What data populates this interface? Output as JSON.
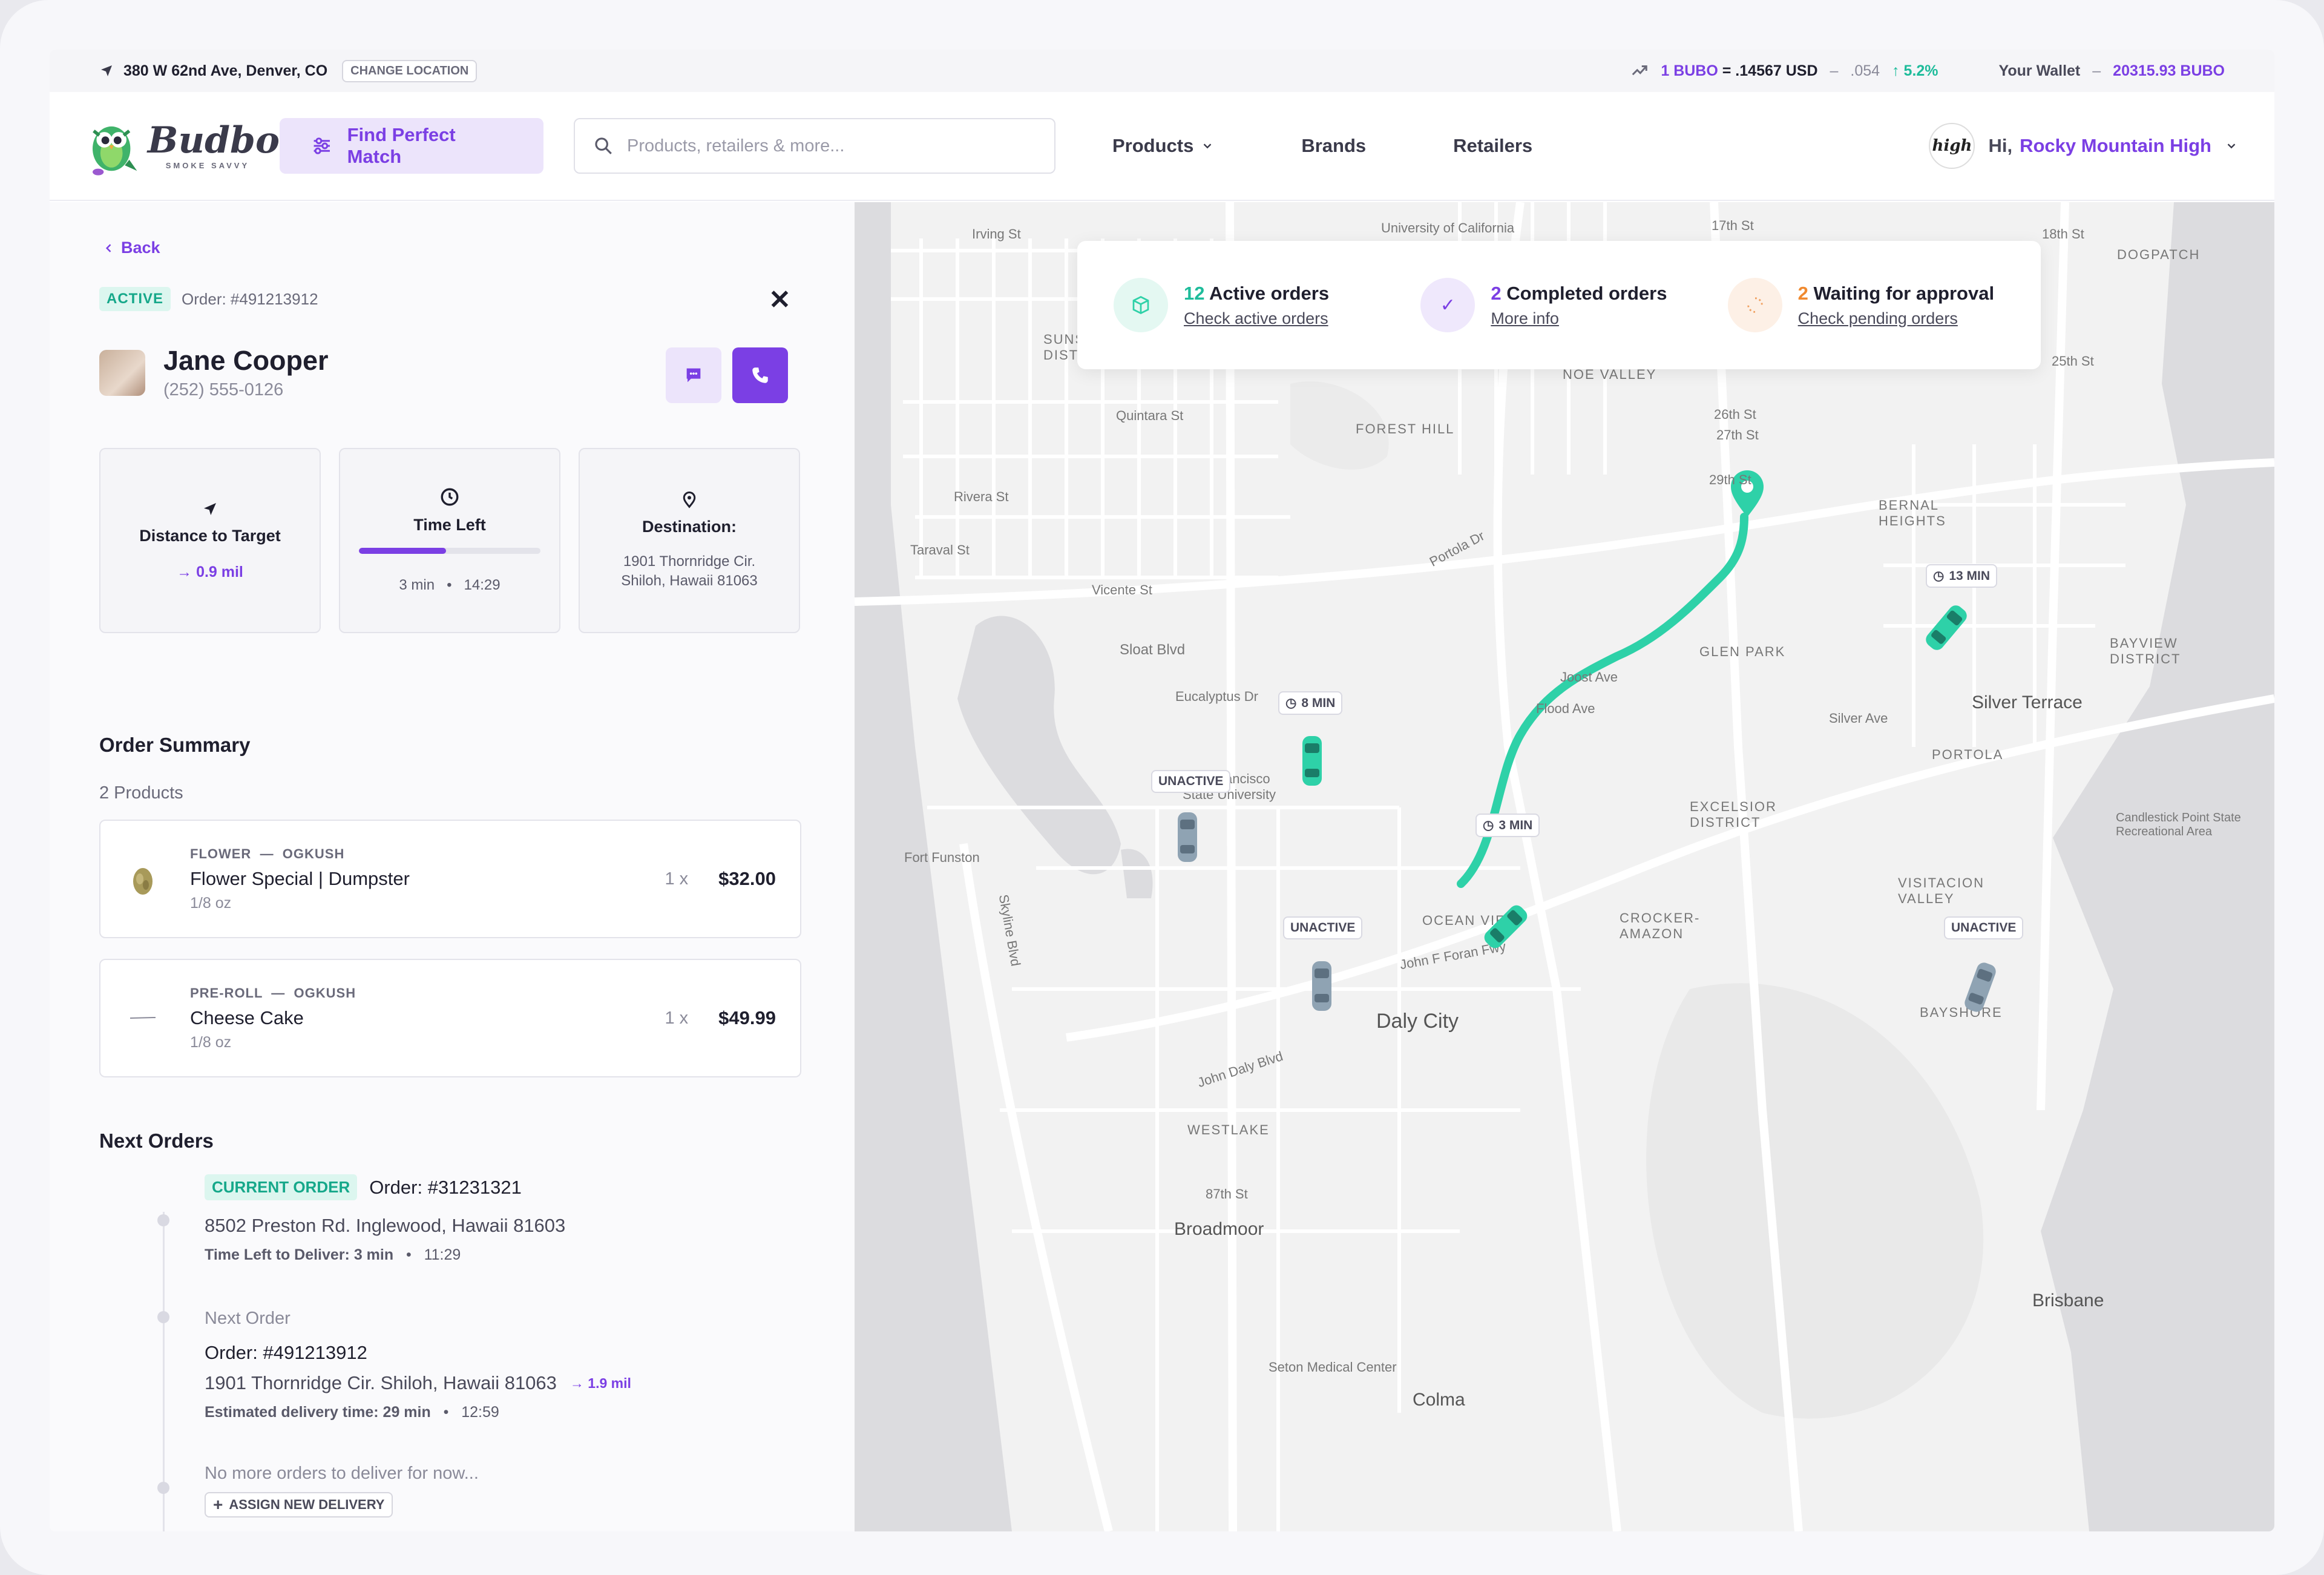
{
  "topbar": {
    "address": "380 W 62nd Ave, Denver, CO",
    "change_location": "CHANGE LOCATION",
    "rate_prefix": "1 BUBO",
    "rate_eq": "= .14567 USD",
    "rate_dash": "–",
    "rate_delta": ".054",
    "rate_change": "↑ 5.2%",
    "wallet_label": "Your Wallet",
    "wallet_dash": "–",
    "wallet_value": "20315.93 BUBO"
  },
  "header": {
    "logo_name": "Budbo",
    "logo_tag": "SMOKE SAVVY",
    "match_button": "Find Perfect Match",
    "search_placeholder": "Products, retailers & more...",
    "nav": [
      "Products",
      "Brands",
      "Retailers"
    ],
    "greeting": "Hi,",
    "user_name": "Rocky Mountain High",
    "avatar_text": "high"
  },
  "order": {
    "back": "Back",
    "status": "ACTIVE",
    "order_no": "Order: #491213912",
    "customer_name": "Jane Cooper",
    "customer_phone": "(252) 555-0126",
    "distance_title": "Distance to Target",
    "distance_value": "0.9 mil",
    "time_title": "Time Left",
    "time_left": "3 min",
    "time_dot": "•",
    "time_clock": "14:29",
    "time_progress": 0.48,
    "dest_title": "Destination:",
    "dest_line1": "1901 Thornridge Cir.",
    "dest_line2": "Shiloh, Hawaii 81063"
  },
  "summary": {
    "title": "Order Summary",
    "count": "2 Products",
    "products": [
      {
        "category": "FLOWER",
        "sep": "—",
        "brand": "OGKUSH",
        "name": "Flower Special | Dumpster",
        "size": "1/8 oz",
        "qty": "1 x",
        "price": "$32.00"
      },
      {
        "category": "PRE-ROLL",
        "sep": "—",
        "brand": "OGKUSH",
        "name": "Cheese Cake",
        "size": "1/8 oz",
        "qty": "1 x",
        "price": "$49.99"
      }
    ]
  },
  "next_orders": {
    "title": "Next Orders",
    "current_badge": "CURRENT ORDER",
    "current_no": "Order: #31231321",
    "current_addr": "8502 Preston Rd. Inglewood, Hawaii 81603",
    "current_time": "Time Left to Deliver: 3 min",
    "current_dot": "•",
    "current_clock": "11:29",
    "next_label": "Next Order",
    "next_no": "Order: #491213912",
    "next_addr": "1901 Thornridge Cir. Shiloh, Hawaii 81063",
    "next_dist": "1.9 mil",
    "next_time": "Estimated delivery time: 29 min",
    "next_dot": "•",
    "next_clock": "12:59",
    "empty": "No more orders  to deliver for now...",
    "assign": "ASSIGN NEW DELIVERY"
  },
  "stats": {
    "active_count": "12",
    "active_label": "Active orders",
    "active_link": "Check active orders",
    "completed_count": "2",
    "completed_label": "Completed orders",
    "completed_link": "More info",
    "waiting_count": "2",
    "waiting_label": "Waiting for approval",
    "waiting_link": "Check pending orders"
  },
  "map": {
    "labels": {
      "irving": "Irving St",
      "ucal": "University of California",
      "st17": "17th St",
      "st18": "18th St",
      "sunset": "SUNSET DISTRICT",
      "noe": "NOE VALLEY",
      "st26": "26th St",
      "st27": "27th St",
      "st29": "29th St",
      "st25": "25th St",
      "quintara": "Quintara St",
      "forest": "FOREST HILL",
      "rivera": "Rivera St",
      "taraval": "Taraval St",
      "portola": "Portola Dr",
      "vicente": "Vicente St",
      "sloat": "Sloat Blvd",
      "bernal": "BERNAL HEIGHTS",
      "glenpark": "GLEN PARK",
      "joost": "Joost Ave",
      "flood": "Flood Ave",
      "eucalyptus": "Eucalyptus Dr",
      "sfsu1": "San Francisco",
      "sfsu2": "State University",
      "silverave": "Silver Ave",
      "silverterrace": "Silver Terrace",
      "portola2": "PORTOLA",
      "bayview": "BAYVIEW DISTRICT",
      "excelsior": "EXCELSIOR DISTRICT",
      "funston": "Fort Funston",
      "oceanview": "OCEAN VIEW",
      "jfkforan": "John F Foran Fwy",
      "crocker": "CROCKER-AMAZON",
      "visitacion": "VISITACION VALLEY",
      "candlestick": "Candlestick Point State Recreational Area",
      "skyline": "Skyline Blvd",
      "dalycity": "Daly City",
      "johndaly": "John Daly Blvd",
      "bayshore": "BAYSHORE",
      "westlake": "WESTLAKE",
      "st87": "87th St",
      "broadmoor": "Broadmoor",
      "brisbane": "Brisbane",
      "seton": "Seton Medical Center",
      "colma": "Colma",
      "dogpatch": "DOGPATCH"
    },
    "pill_8": "8 MIN",
    "pill_3": "3 MIN",
    "pill_13": "13 MIN",
    "unactive": "UNACTIVE",
    "route_color": "#2ed1a8"
  }
}
